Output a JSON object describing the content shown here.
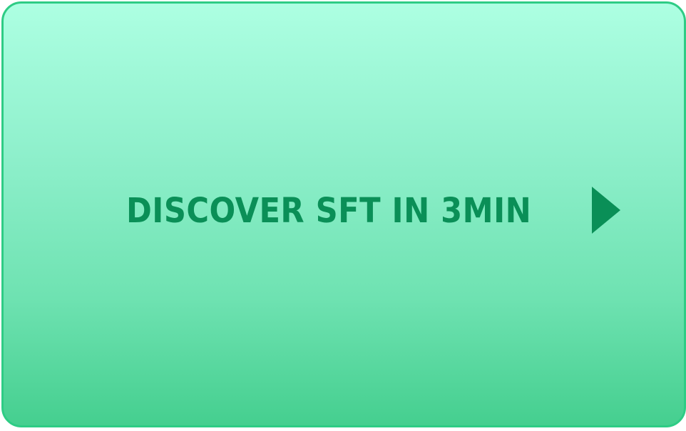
{
  "cta": {
    "label": "DISCOVER SFT IN 3MIN",
    "icon": "play-arrow-icon"
  },
  "colors": {
    "border": "#2ecc85",
    "gradient_top": "#adffe2",
    "gradient_bottom": "#45cf8f",
    "text": "#0a8f57"
  }
}
